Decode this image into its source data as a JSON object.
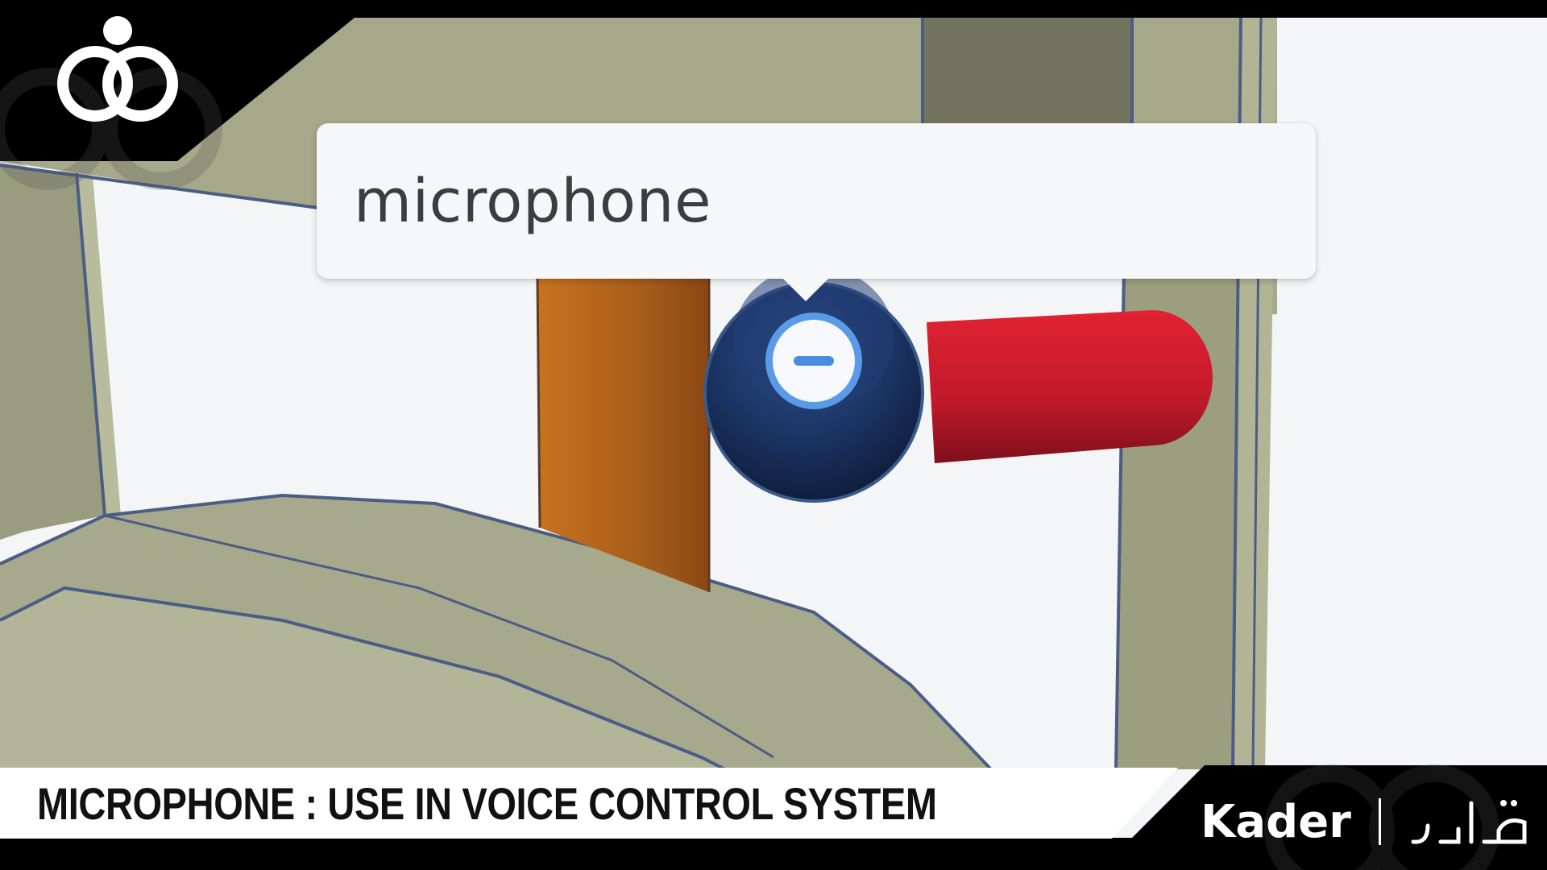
{
  "tooltip": {
    "text": "microphone"
  },
  "caption": {
    "text": "MICROPHONE : USE IN VOICE CONTROL SYSTEM"
  },
  "brand": {
    "name": "Kader",
    "arabic_name": "قادر"
  },
  "component": {
    "body_color": "#1b3464",
    "handle_color": "#c8192a",
    "wire_color": "#b4621c"
  },
  "icons": {
    "component_button": "minus-icon",
    "logo": "rings-logo-icon"
  },
  "colors": {
    "frame_olive": "#a7a98c",
    "background": "#f4f5f6",
    "overlay_black": "#000000"
  }
}
